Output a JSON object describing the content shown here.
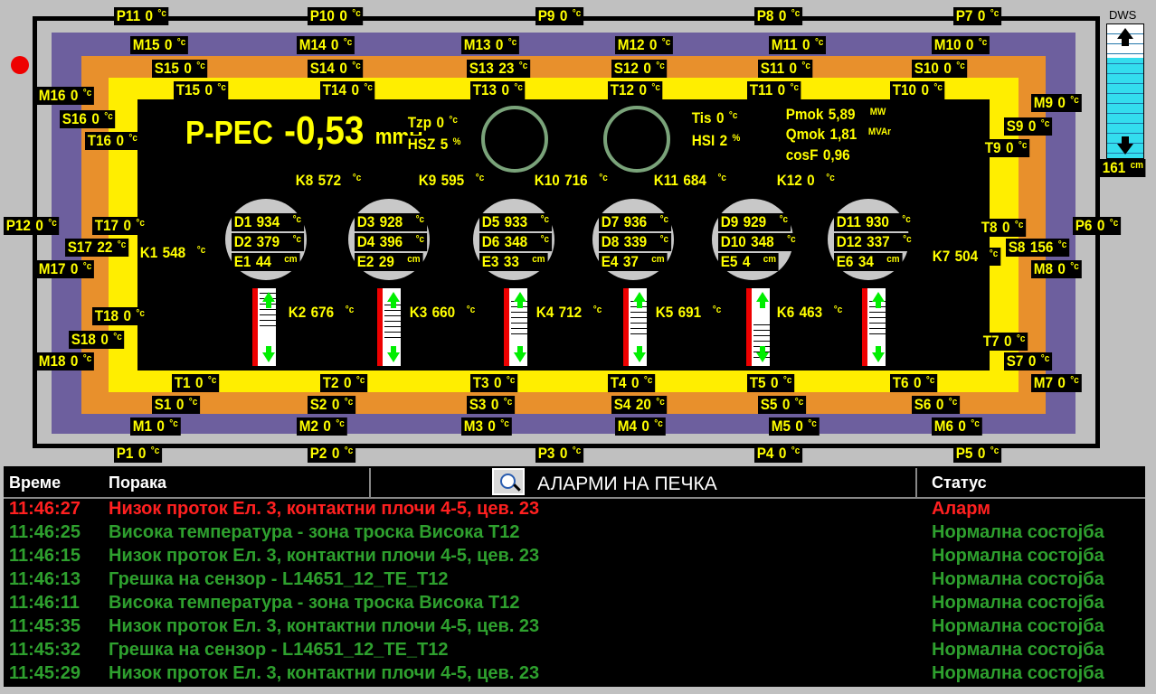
{
  "furnace": {
    "ppec_label": "P-PEC",
    "ppec_value": "-0,53",
    "ppec_unit": "mmH",
    "tzp": {
      "label": "Tzp",
      "value": "0",
      "unit": "°c"
    },
    "hsz": {
      "label": "HSZ",
      "value": "5",
      "unit": "%"
    },
    "tis": {
      "label": "Tis",
      "value": "0",
      "unit": "°c"
    },
    "hsi": {
      "label": "HSI",
      "value": "2",
      "unit": "%"
    },
    "pmok": {
      "label": "Pmok",
      "value": "5,89",
      "unit": "MW"
    },
    "qmok": {
      "label": "Qmok",
      "value": "1,81",
      "unit": "MVAr"
    },
    "cosf": {
      "label": "cosF",
      "value": "0,96"
    },
    "dws": {
      "label": "DWS",
      "value": "161",
      "unit": "cm",
      "level_fraction": 0.75
    },
    "status_indicator_color": "#ee0000",
    "colors": {
      "purple": "#6d5f9e",
      "orange": "#e8902c",
      "yellow": "#ffee00",
      "text": "#ffff00",
      "bg": "#000000"
    }
  },
  "p_sensors": [
    {
      "id": "P11",
      "value": "0",
      "unit": "°c"
    },
    {
      "id": "P10",
      "value": "0",
      "unit": "°c"
    },
    {
      "id": "P9",
      "value": "0",
      "unit": "°c"
    },
    {
      "id": "P8",
      "value": "0",
      "unit": "°c"
    },
    {
      "id": "P7",
      "value": "0",
      "unit": "°c"
    },
    {
      "id": "P12",
      "value": "0",
      "unit": "°c"
    },
    {
      "id": "P6",
      "value": "0",
      "unit": "°c"
    },
    {
      "id": "P1",
      "value": "0",
      "unit": "°c"
    },
    {
      "id": "P2",
      "value": "0",
      "unit": "°c"
    },
    {
      "id": "P3",
      "value": "0",
      "unit": "°c"
    },
    {
      "id": "P4",
      "value": "0",
      "unit": "°c"
    },
    {
      "id": "P5",
      "value": "0",
      "unit": "°c"
    }
  ],
  "m_sensors": [
    {
      "id": "M15",
      "value": "0",
      "unit": "°c"
    },
    {
      "id": "M14",
      "value": "0",
      "unit": "°c"
    },
    {
      "id": "M13",
      "value": "0",
      "unit": "°c"
    },
    {
      "id": "M12",
      "value": "0",
      "unit": "°c"
    },
    {
      "id": "M11",
      "value": "0",
      "unit": "°c"
    },
    {
      "id": "M10",
      "value": "0",
      "unit": "°c"
    },
    {
      "id": "M16",
      "value": "0",
      "unit": "°c"
    },
    {
      "id": "M9",
      "value": "0",
      "unit": "°c"
    },
    {
      "id": "M17",
      "value": "0",
      "unit": "°c"
    },
    {
      "id": "M8",
      "value": "0",
      "unit": "°c"
    },
    {
      "id": "M18",
      "value": "0",
      "unit": "°c"
    },
    {
      "id": "M7",
      "value": "0",
      "unit": "°c"
    },
    {
      "id": "M1",
      "value": "0",
      "unit": "°c"
    },
    {
      "id": "M2",
      "value": "0",
      "unit": "°c"
    },
    {
      "id": "M3",
      "value": "0",
      "unit": "°c"
    },
    {
      "id": "M4",
      "value": "0",
      "unit": "°c"
    },
    {
      "id": "M5",
      "value": "0",
      "unit": "°c"
    },
    {
      "id": "M6",
      "value": "0",
      "unit": "°c"
    }
  ],
  "s_sensors": [
    {
      "id": "S15",
      "value": "0",
      "unit": "°c"
    },
    {
      "id": "S14",
      "value": "0",
      "unit": "°c"
    },
    {
      "id": "S13",
      "value": "23",
      "unit": "°c"
    },
    {
      "id": "S12",
      "value": "0",
      "unit": "°c"
    },
    {
      "id": "S11",
      "value": "0",
      "unit": "°c"
    },
    {
      "id": "S10",
      "value": "0",
      "unit": "°c"
    },
    {
      "id": "S16",
      "value": "0",
      "unit": "°c"
    },
    {
      "id": "S9",
      "value": "0",
      "unit": "°c"
    },
    {
      "id": "S17",
      "value": "22",
      "unit": "°c"
    },
    {
      "id": "S8",
      "value": "156",
      "unit": "°c"
    },
    {
      "id": "S18",
      "value": "0",
      "unit": "°c"
    },
    {
      "id": "S7",
      "value": "0",
      "unit": "°c"
    },
    {
      "id": "S1",
      "value": "0",
      "unit": "°c"
    },
    {
      "id": "S2",
      "value": "0",
      "unit": "°c"
    },
    {
      "id": "S3",
      "value": "0",
      "unit": "°c"
    },
    {
      "id": "S4",
      "value": "20",
      "unit": "°c"
    },
    {
      "id": "S5",
      "value": "0",
      "unit": "°c"
    },
    {
      "id": "S6",
      "value": "0",
      "unit": "°c"
    }
  ],
  "t_sensors": [
    {
      "id": "T15",
      "value": "0",
      "unit": "°c"
    },
    {
      "id": "T14",
      "value": "0",
      "unit": "°c"
    },
    {
      "id": "T13",
      "value": "0",
      "unit": "°c"
    },
    {
      "id": "T12",
      "value": "0",
      "unit": "°c"
    },
    {
      "id": "T11",
      "value": "0",
      "unit": "°c"
    },
    {
      "id": "T10",
      "value": "0",
      "unit": "°c"
    },
    {
      "id": "T16",
      "value": "0",
      "unit": "°c"
    },
    {
      "id": "T9",
      "value": "0",
      "unit": "°c"
    },
    {
      "id": "T17",
      "value": "0",
      "unit": "°c"
    },
    {
      "id": "T8",
      "value": "0",
      "unit": "°c"
    },
    {
      "id": "T18",
      "value": "0",
      "unit": "°c"
    },
    {
      "id": "T7",
      "value": "0",
      "unit": "°c"
    },
    {
      "id": "T1",
      "value": "0",
      "unit": "°c"
    },
    {
      "id": "T2",
      "value": "0",
      "unit": "°c"
    },
    {
      "id": "T3",
      "value": "0",
      "unit": "°c"
    },
    {
      "id": "T4",
      "value": "0",
      "unit": "°c"
    },
    {
      "id": "T5",
      "value": "0",
      "unit": "°c"
    },
    {
      "id": "T6",
      "value": "0",
      "unit": "°c"
    }
  ],
  "k_sensors": [
    {
      "id": "K8",
      "value": "572",
      "unit": "°c"
    },
    {
      "id": "K9",
      "value": "595",
      "unit": "°c"
    },
    {
      "id": "K10",
      "value": "716",
      "unit": "°c"
    },
    {
      "id": "K11",
      "value": "684",
      "unit": "°c"
    },
    {
      "id": "K12",
      "value": "0",
      "unit": "°c"
    },
    {
      "id": "K1",
      "value": "548",
      "unit": "°c"
    },
    {
      "id": "K7",
      "value": "504",
      "unit": "°c"
    },
    {
      "id": "K2",
      "value": "676",
      "unit": "°c"
    },
    {
      "id": "K3",
      "value": "660",
      "unit": "°c"
    },
    {
      "id": "K4",
      "value": "712",
      "unit": "°c"
    },
    {
      "id": "K5",
      "value": "691",
      "unit": "°c"
    },
    {
      "id": "K6",
      "value": "463",
      "unit": "°c"
    }
  ],
  "electrodes": [
    {
      "d_top": "D1",
      "d_top_val": "934",
      "d_bot": "D2",
      "d_bot_val": "379",
      "e": "E1",
      "e_val": "44",
      "t_unit": "°c",
      "e_unit": "cm",
      "level_fraction": 0.45
    },
    {
      "d_top": "D3",
      "d_top_val": "928",
      "d_bot": "D4",
      "d_bot_val": "396",
      "e": "E2",
      "e_val": "29",
      "t_unit": "°c",
      "e_unit": "cm",
      "level_fraction": 0.3
    },
    {
      "d_top": "D5",
      "d_top_val": "933",
      "d_bot": "D6",
      "d_bot_val": "348",
      "e": "E3",
      "e_val": "33",
      "t_unit": "°c",
      "e_unit": "cm",
      "level_fraction": 0.35
    },
    {
      "d_top": "D7",
      "d_top_val": "936",
      "d_bot": "D8",
      "d_bot_val": "339",
      "e": "E4",
      "e_val": "37",
      "t_unit": "°c",
      "e_unit": "cm",
      "level_fraction": 0.35
    },
    {
      "d_top": "D9",
      "d_top_val": "929",
      "d_bot": "D10",
      "d_bot_val": "348",
      "e": "E5",
      "e_val": "4",
      "t_unit": "°c",
      "e_unit": "cm",
      "level_fraction": 0.05
    },
    {
      "d_top": "D11",
      "d_top_val": "930",
      "d_bot": "D12",
      "d_bot_val": "337",
      "e": "E6",
      "e_val": "34",
      "t_unit": "°c",
      "e_unit": "cm",
      "level_fraction": 0.35
    }
  ],
  "alarms": {
    "header_time": "Време",
    "header_message": "Порака",
    "header_status": "Статус",
    "title": "АЛАРМИ НА ПЕЧКА",
    "rows": [
      {
        "time": "11:46:27",
        "message": "Низок проток Ел. 3, контактни плочи 4-5, цев. 23",
        "status": "Аларм",
        "color": "#ff2020"
      },
      {
        "time": "11:46:25",
        "message": "Висока температура - зона троска Висока Т12",
        "status": "Нормална состојба",
        "color": "#2ea02e"
      },
      {
        "time": "11:46:15",
        "message": "Низок проток Ел. 3, контактни плочи 4-5, цев. 23",
        "status": "Нормална состојба",
        "color": "#2ea02e"
      },
      {
        "time": "11:46:13",
        "message": "Грешка на сензор - L14651_12_TE_T12",
        "status": "Нормална состојба",
        "color": "#2ea02e"
      },
      {
        "time": "11:46:11",
        "message": "Висока температура - зона троска Висока Т12",
        "status": "Нормална состојба",
        "color": "#2ea02e"
      },
      {
        "time": "11:45:35",
        "message": "Низок проток Ел. 3, контактни плочи 4-5, цев. 23",
        "status": "Нормална состојба",
        "color": "#2ea02e"
      },
      {
        "time": "11:45:32",
        "message": "Грешка на сензор - L14651_12_TE_T12",
        "status": "Нормална состојба",
        "color": "#2ea02e"
      },
      {
        "time": "11:45:29",
        "message": "Низок проток Ел. 3, контактни плочи 4-5, цев. 23",
        "status": "Нормална состојба",
        "color": "#2ea02e"
      }
    ]
  }
}
